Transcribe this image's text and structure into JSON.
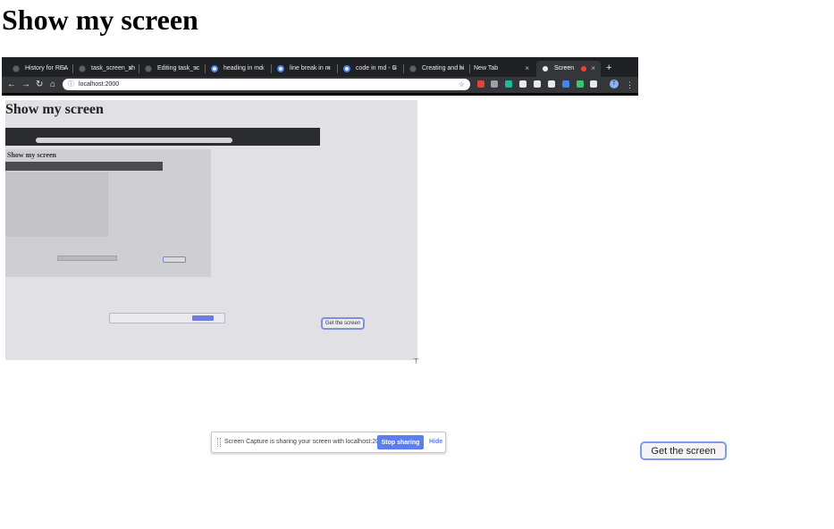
{
  "page": {
    "title": "Show my screen"
  },
  "browser": {
    "tabs": [
      {
        "label": "History for REA",
        "icon": "github-icon"
      },
      {
        "label": "task_screen_sh",
        "icon": "github-icon"
      },
      {
        "label": "Editing task_sc",
        "icon": "github-icon"
      },
      {
        "label": "heading in md",
        "icon": "chrome-icon"
      },
      {
        "label": "line break in m",
        "icon": "chrome-icon"
      },
      {
        "label": "code in md - G",
        "icon": "chrome-icon"
      },
      {
        "label": "Creating and hi",
        "icon": "github-icon"
      },
      {
        "label": "New Tab",
        "icon": ""
      },
      {
        "label": "Screen",
        "icon": "app-icon",
        "active": true
      }
    ],
    "url": "localhost:2000",
    "profile_initial": "T",
    "extension_colors": [
      "#ea4335",
      "#9aa0a6",
      "#1abc9c",
      "#e8eaed",
      "#e8eaed",
      "#e8eaed",
      "#4285f4",
      "#2ecc71",
      "#e8eaed"
    ]
  },
  "nested": {
    "title": "Show my screen",
    "inner_title": "Show my screen",
    "button_label": "Get the screen"
  },
  "notification": {
    "message": "Screen Capture is sharing your screen with localhost:2000.",
    "stop_label": "Stop sharing",
    "hide_label": "Hide"
  },
  "actions": {
    "get_screen_label": "Get the screen"
  }
}
